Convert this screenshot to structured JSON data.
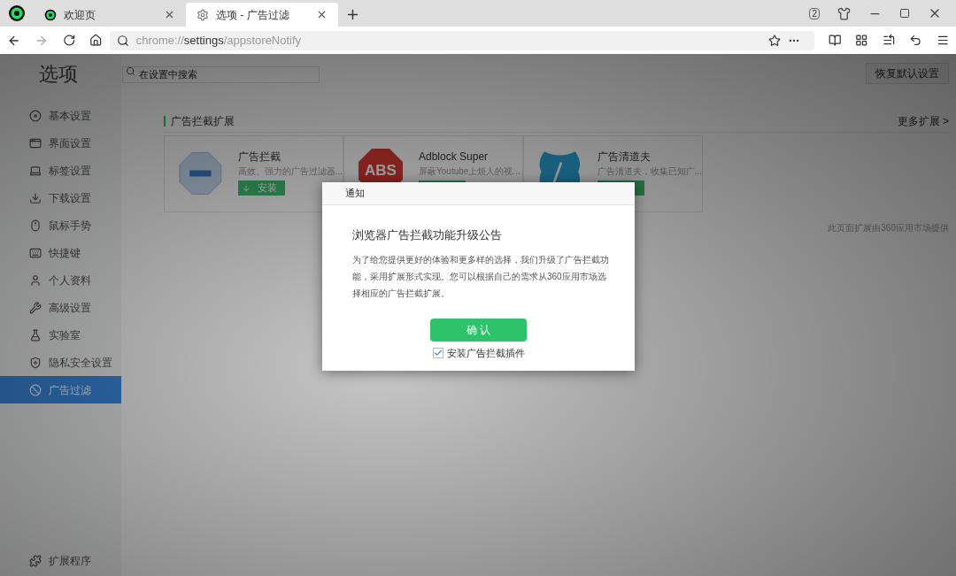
{
  "tabs": [
    {
      "label": "欢迎页",
      "kind": "welcome",
      "selected": false
    },
    {
      "label": "选项 - 广告过滤",
      "kind": "settings",
      "selected": true
    }
  ],
  "window_controls": {
    "tab_count": "2"
  },
  "address_bar": {
    "scheme": "chrome://",
    "host": "settings",
    "path": "/appstoreNotify"
  },
  "page": {
    "title": "选项",
    "search": {
      "placeholder": "在设置中搜索"
    },
    "restore_button": "恢复默认设置"
  },
  "sidebar": {
    "items": [
      {
        "label": "基本设置",
        "kind": "basic",
        "selected": false
      },
      {
        "label": "界面设置",
        "kind": "ui",
        "selected": false
      },
      {
        "label": "标签设置",
        "kind": "tabs",
        "selected": false
      },
      {
        "label": "下载设置",
        "kind": "download",
        "selected": false
      },
      {
        "label": "鼠标手势",
        "kind": "mouse",
        "selected": false
      },
      {
        "label": "快捷键",
        "kind": "keys",
        "selected": false
      },
      {
        "label": "个人资料",
        "kind": "profile",
        "selected": false
      },
      {
        "label": "高级设置",
        "kind": "advanced",
        "selected": false
      },
      {
        "label": "实验室",
        "kind": "lab",
        "selected": false
      },
      {
        "label": "隐私安全设置",
        "kind": "privacy",
        "selected": false
      },
      {
        "label": "广告过滤",
        "kind": "adfilter",
        "selected": true
      }
    ],
    "footer_item": "扩展程序"
  },
  "section": {
    "title": "广告拦截扩展",
    "more_link": "更多扩展 >",
    "note": "此页面扩展由360应用市场提供",
    "cards": [
      {
        "name": "广告拦截",
        "description": "高效、强力的广告过滤器...",
        "kind": "stop",
        "button_label": "安装"
      },
      {
        "name": "Adblock Super",
        "description": "屏蔽Youtube上烦人的视...",
        "kind": "abs",
        "logo_text": "ABS"
      },
      {
        "name": "广告清道夫",
        "description": "广告清道夫，收集已知广...",
        "kind": "shield"
      }
    ]
  },
  "dialog": {
    "title": "通知",
    "heading": "浏览器广告拦截功能升级公告",
    "body": "为了给您提供更好的体验和更多样的选择，我们升级了广告拦截功能，采用扩展形式实现。您可以根据自己的需求从360应用市场选择相应的广告拦截扩展。",
    "confirm_button": "确 认",
    "checkbox": {
      "label": "安装广告拦截插件",
      "checked": true
    }
  }
}
